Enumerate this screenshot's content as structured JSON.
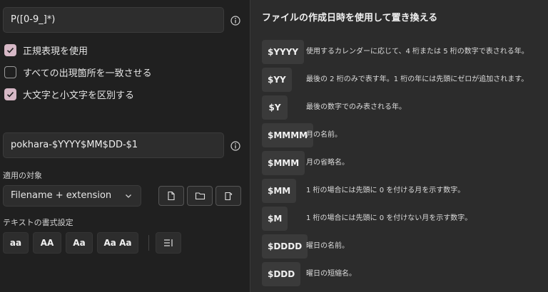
{
  "search": {
    "value": "P([0-9_]*)"
  },
  "options": [
    {
      "label": "正規表現を使用",
      "checked": true
    },
    {
      "label": "すべての出現箇所を一致させる",
      "checked": false
    },
    {
      "label": "大文字と小文字を区別する",
      "checked": true
    }
  ],
  "replace": {
    "value": "pokhara-$YYYY$MM$DD-$1"
  },
  "apply_to": {
    "label": "適用の対象",
    "selected": "Filename + extension"
  },
  "text_format": {
    "label": "テキストの書式設定",
    "buttons": [
      "aa",
      "AA",
      "Aa",
      "Aa Aa"
    ]
  },
  "panel": {
    "title": "ファイルの作成日時を使用して置き換える",
    "items": [
      {
        "token": "$YYYY",
        "desc": "使用するカレンダーに応じて、4 桁または 5 桁の数字で表される年。"
      },
      {
        "token": "$YY",
        "desc": "最後の 2 桁のみで表す年。1 桁の年には先頭にゼロが追加されます。"
      },
      {
        "token": "$Y",
        "desc": "最後の数字でのみ表される年。"
      },
      {
        "token": "$MMMM",
        "desc": "月の名前。"
      },
      {
        "token": "$MMM",
        "desc": "月の省略名。"
      },
      {
        "token": "$MM",
        "desc": "1 桁の場合には先頭に 0 を付ける月を示す数字。"
      },
      {
        "token": "$M",
        "desc": "1 桁の場合には先頭に 0 を付けない月を示す数字。"
      },
      {
        "token": "$DDDD",
        "desc": "曜日の名前。"
      },
      {
        "token": "$DDD",
        "desc": "曜日の短縮名。"
      }
    ]
  }
}
